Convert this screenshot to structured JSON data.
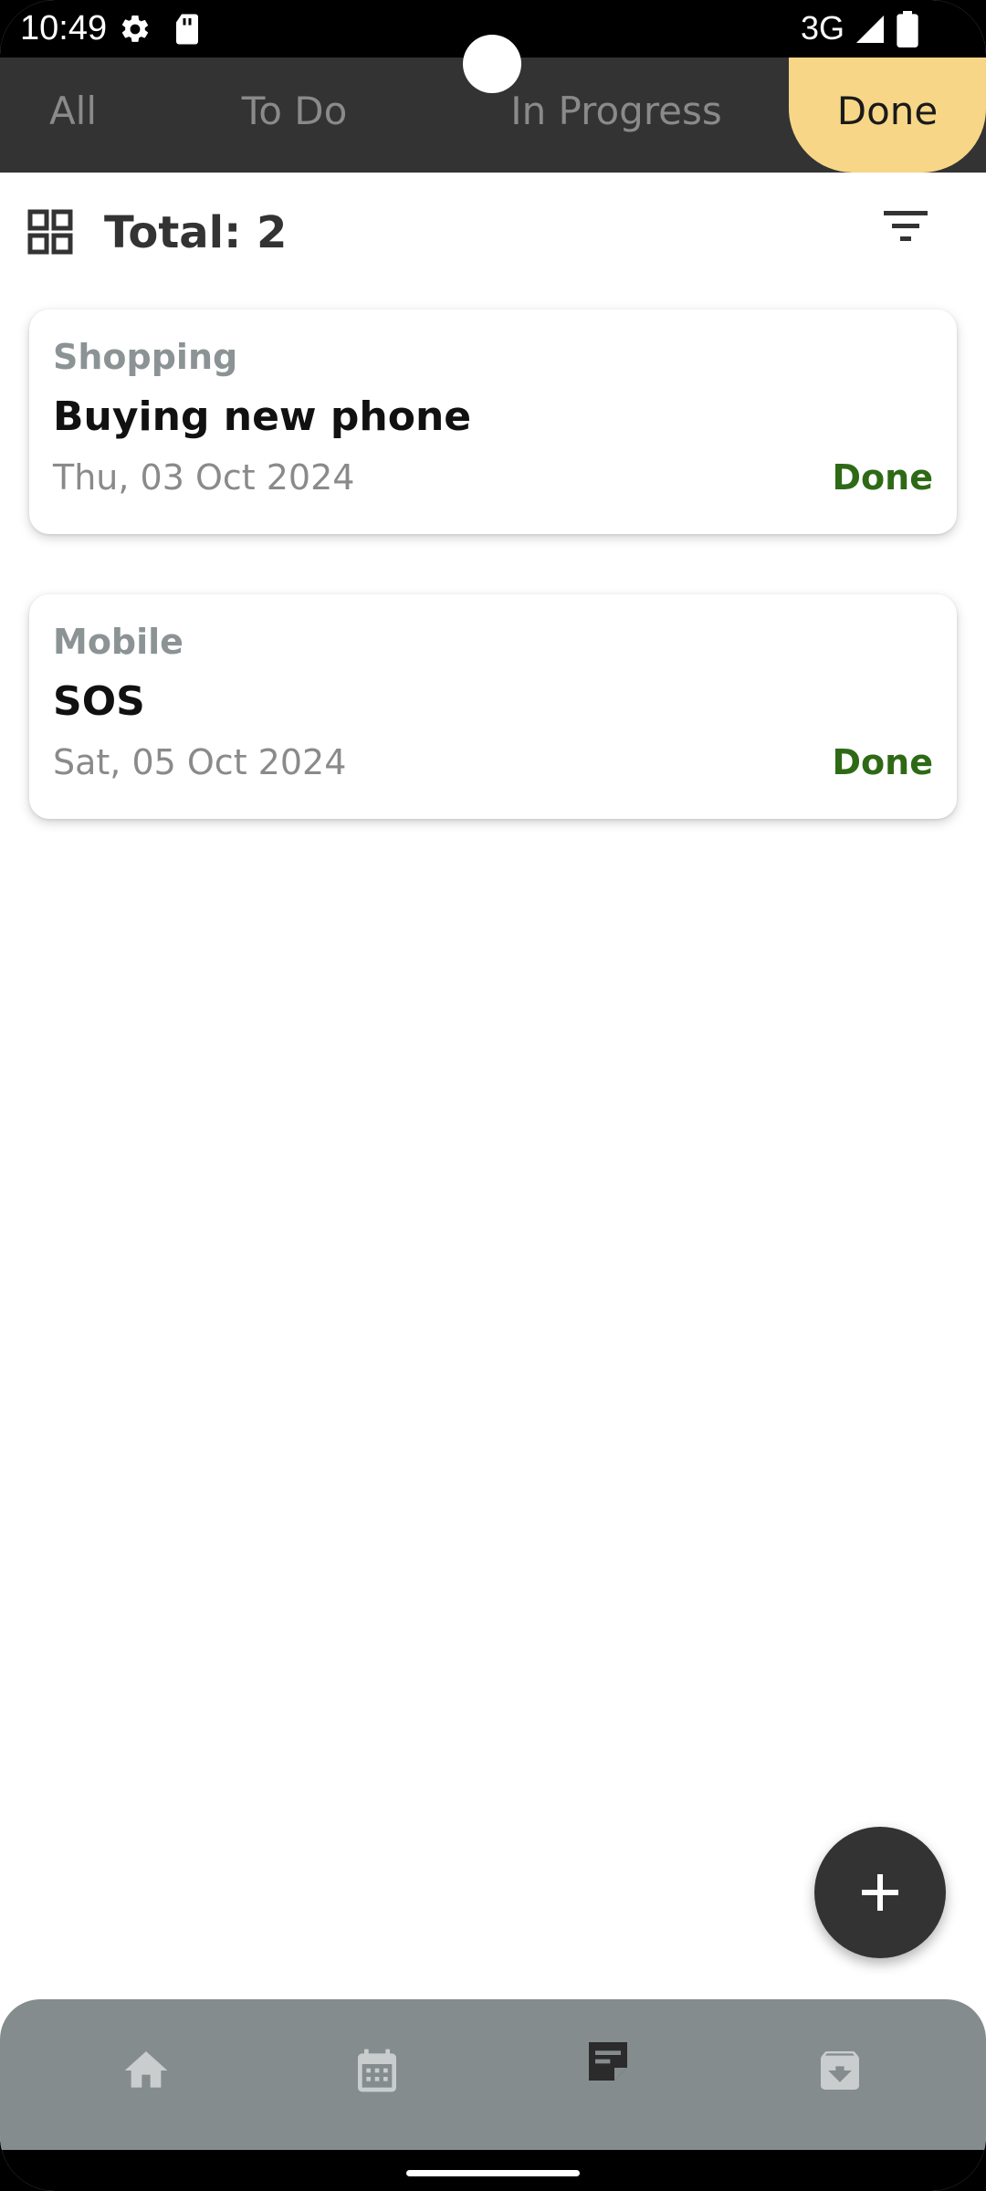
{
  "status_bar": {
    "time": "10:49",
    "network": "3G",
    "icons": [
      "gear-icon",
      "sd-card-icon",
      "signal-icon",
      "battery-icon"
    ]
  },
  "tabs": [
    {
      "label": "All",
      "selected": false
    },
    {
      "label": "To Do",
      "selected": false
    },
    {
      "label": "In Progress",
      "selected": false
    },
    {
      "label": "Done",
      "selected": true
    }
  ],
  "header": {
    "total_label": "Total: 2"
  },
  "tasks": [
    {
      "category": "Shopping",
      "title": "Buying new phone",
      "date": "Thu, 03 Oct 2024",
      "status": "Done"
    },
    {
      "category": "Mobile",
      "title": "SOS",
      "date": "Sat, 05 Oct 2024",
      "status": "Done"
    }
  ],
  "bottom_nav": {
    "items": [
      "home-icon",
      "calendar-icon",
      "notes-icon",
      "archive-icon"
    ],
    "active": "notes-icon"
  },
  "colors": {
    "tab_bar_bg": "#333333",
    "selected_tab_bg": "#f7d687",
    "status_done": "#2e6a16",
    "bottom_nav_bg": "#858c8d",
    "fab_bg": "#333333"
  }
}
